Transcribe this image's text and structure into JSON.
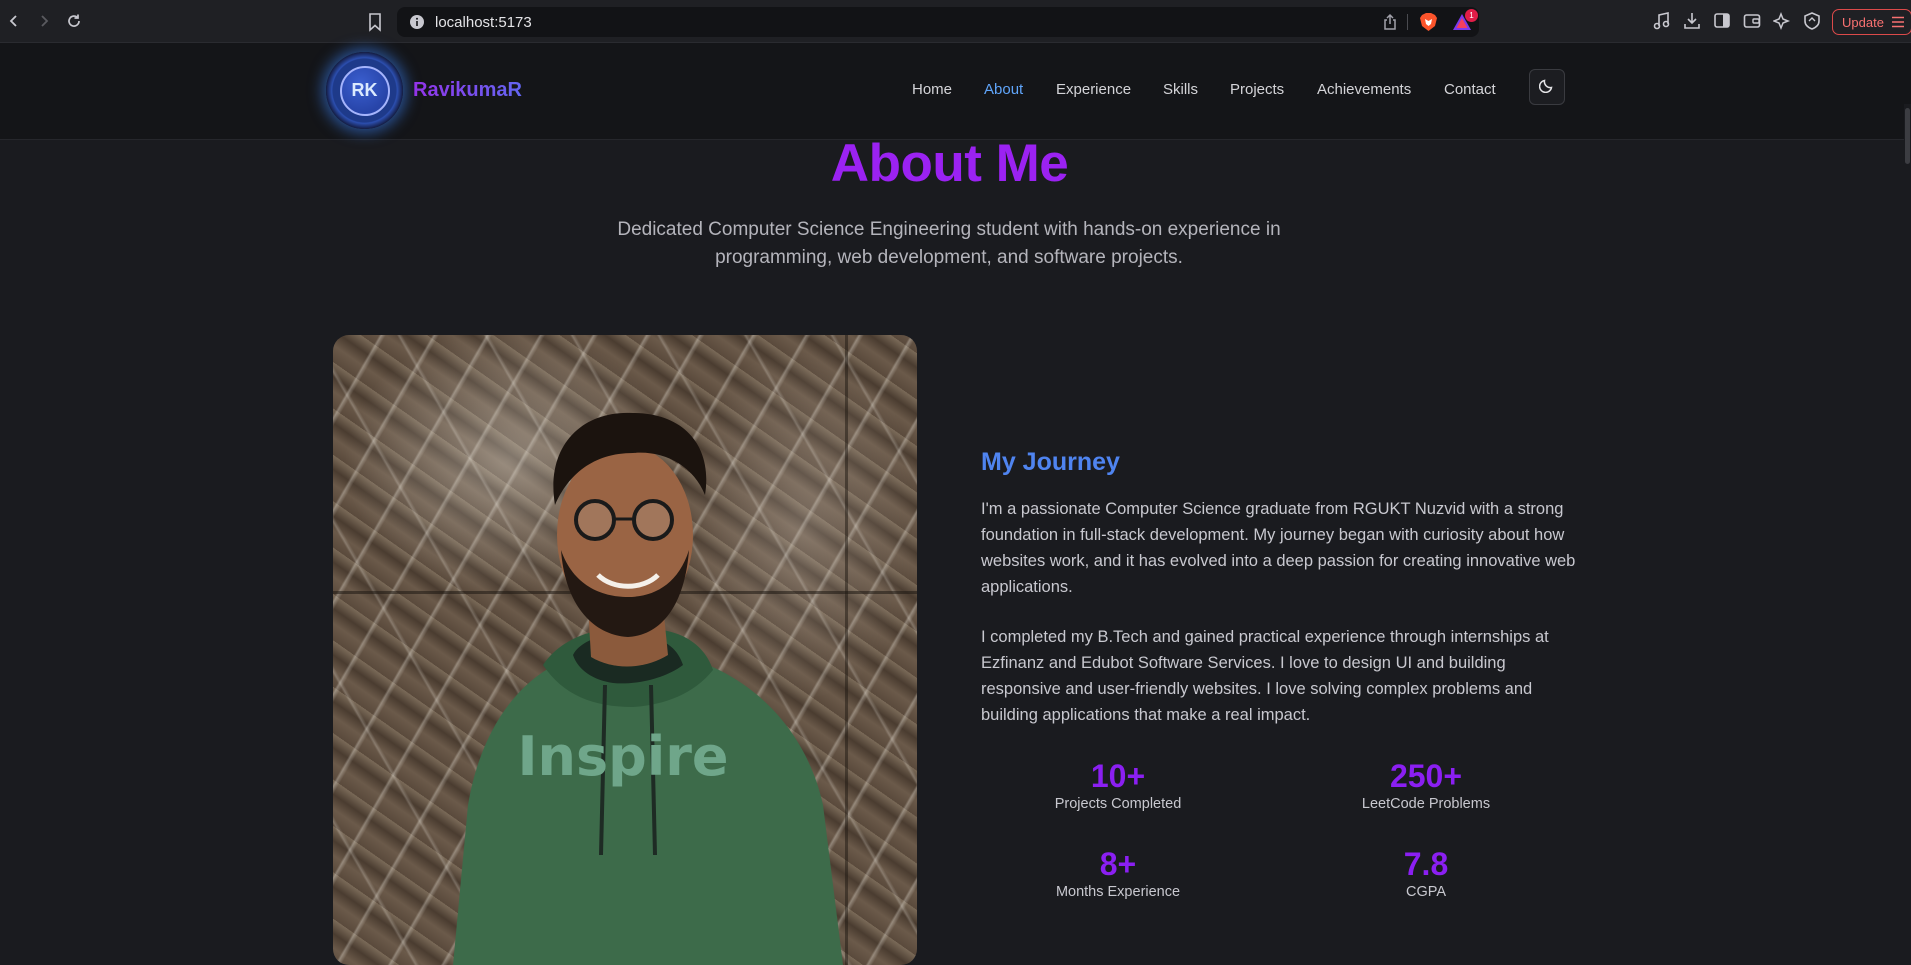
{
  "browser": {
    "url": "localhost:5173",
    "rewards_count": "1",
    "update_label": "Update"
  },
  "site": {
    "logo_initials": "RK",
    "brand_name": "RavikumaR",
    "nav": [
      {
        "label": "Home",
        "active": false
      },
      {
        "label": "About",
        "active": true
      },
      {
        "label": "Experience",
        "active": false
      },
      {
        "label": "Skills",
        "active": false
      },
      {
        "label": "Projects",
        "active": false
      },
      {
        "label": "Achievements",
        "active": false
      },
      {
        "label": "Contact",
        "active": false
      }
    ],
    "theme_toggle_icon": "moon-icon"
  },
  "about": {
    "title": "About Me",
    "subtitle": "Dedicated Computer Science Engineering student with hands-on experience in programming, web development, and software projects.",
    "photo_alt": "Portrait photo of Ravikumar wearing a green Inspire hoodie",
    "photo_hoodie_text": "Inspire",
    "journey_title": "My Journey",
    "paragraphs": [
      "I'm a passionate Computer Science graduate from RGUKT Nuzvid with a strong foundation in full-stack development. My journey began with curiosity about how websites work, and it has evolved into a deep passion for creating innovative web applications.",
      "I completed my B.Tech and gained practical experience through internships at Ezfinanz and Edubot Software Services. I love to design UI and building responsive and user-friendly websites. I love solving complex problems and building applications that make a real impact."
    ],
    "stats": [
      {
        "value": "10+",
        "label": "Projects Completed"
      },
      {
        "value": "250+",
        "label": "LeetCode Problems"
      },
      {
        "value": "8+",
        "label": "Months Experience"
      },
      {
        "value": "7.8",
        "label": "CGPA"
      }
    ]
  },
  "colors": {
    "accent_purple": "#9b22f2",
    "accent_blue": "#4f84f0",
    "background": "#1a1b1f"
  }
}
